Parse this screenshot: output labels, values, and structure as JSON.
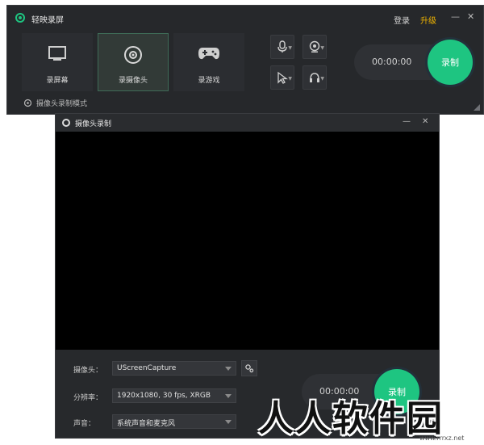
{
  "main_window": {
    "title": "轻映录屏",
    "login_label": "登录",
    "upgrade_label": "升级",
    "minimize_glyph": "—",
    "close_glyph": "✕",
    "modes": [
      {
        "label": "录屏幕",
        "icon": "monitor-icon",
        "active": false
      },
      {
        "label": "录摄像头",
        "icon": "webcam-icon",
        "active": true
      },
      {
        "label": "录游戏",
        "icon": "gamepad-icon",
        "active": false
      }
    ],
    "tools": [
      {
        "icon": "microphone-icon"
      },
      {
        "icon": "camera-icon"
      },
      {
        "icon": "cursor-icon"
      },
      {
        "icon": "speaker-icon"
      }
    ],
    "timer": "00:00:00",
    "record_label": "录制",
    "mode_hint": "摄像头录制模式",
    "accent_color": "#1ec581",
    "upgrade_color": "#f0b400"
  },
  "camera_window": {
    "title": "摄像头录制",
    "minimize_glyph": "—",
    "close_glyph": "✕",
    "settings": [
      {
        "label": "摄像头：",
        "value": "UScreenCapture"
      },
      {
        "label": "分辨率：",
        "value": "1920x1080, 30 fps, XRGB"
      },
      {
        "label": "声音：",
        "value": "系统声音和麦克风"
      }
    ],
    "timer": "00:00:00",
    "record_label": "录制"
  },
  "watermark": {
    "text": "人人软件园",
    "sub": "www.rrrxz.net"
  }
}
